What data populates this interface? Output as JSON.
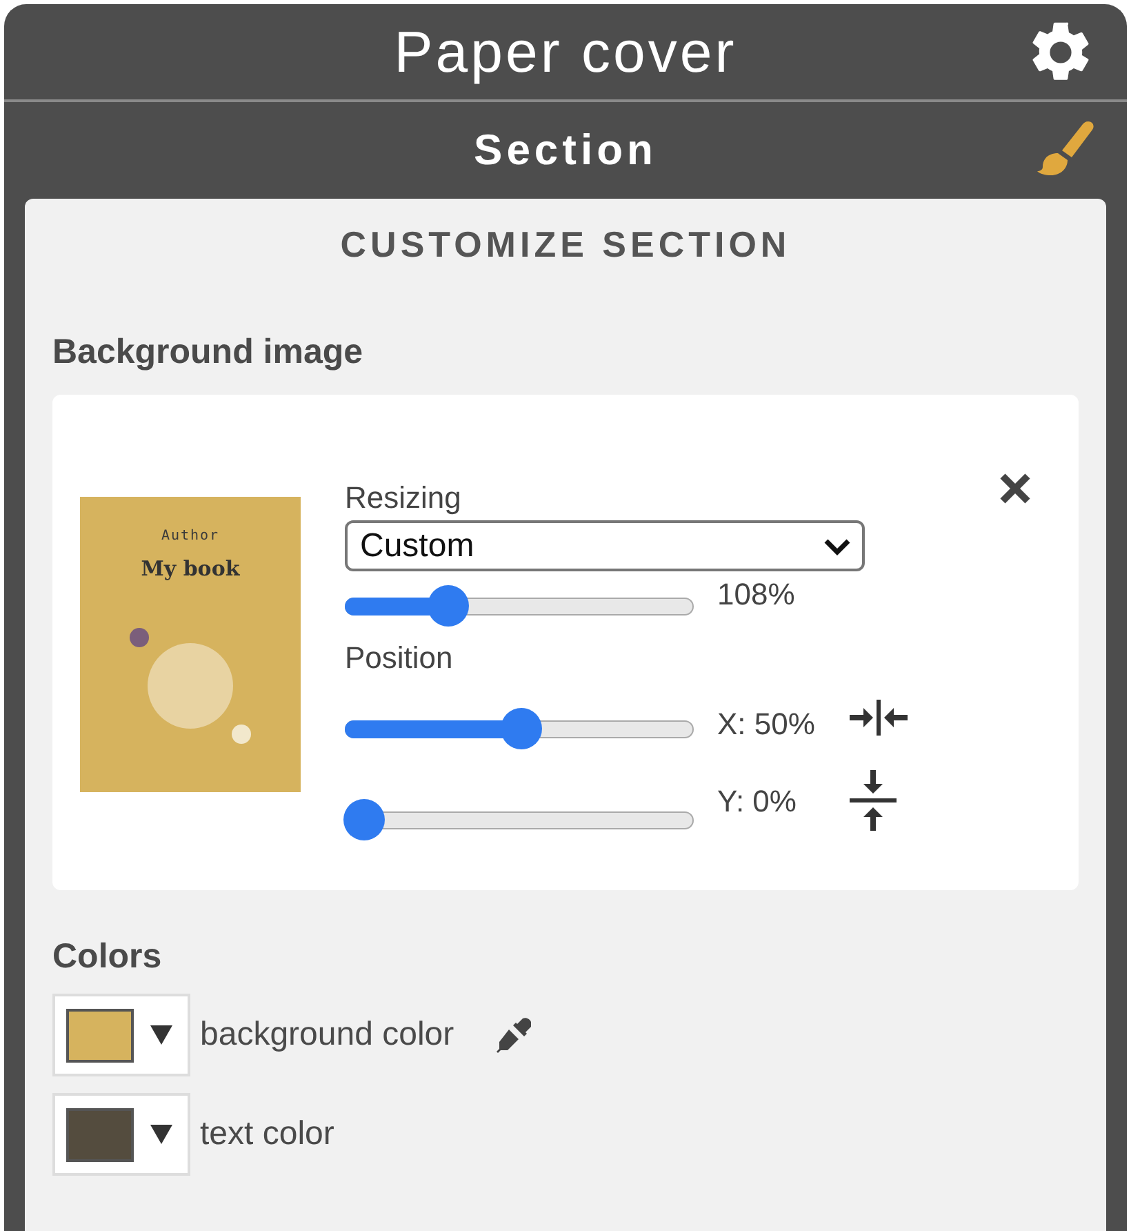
{
  "window": {
    "title": "Paper cover"
  },
  "section": {
    "title": "Section"
  },
  "panel": {
    "heading": "CUSTOMIZE SECTION",
    "background_image": {
      "label": "Background image",
      "cover": {
        "author": "Author",
        "title": "My book"
      },
      "resizing": {
        "label": "Resizing",
        "value": "Custom",
        "level": 0.27,
        "reading": "108%"
      },
      "position": {
        "label": "Position",
        "sliders": [
          {
            "kind": "horizontal",
            "level": 0.5,
            "reading": "X: 50%"
          },
          {
            "kind": "vertical",
            "level": 0,
            "reading": "Y: 0%"
          }
        ]
      }
    },
    "colors": {
      "label": "Colors",
      "items": [
        {
          "label": "background color",
          "color": "#d6b35e",
          "eyedropper": true
        },
        {
          "label": "text color",
          "color": "#544c3e",
          "eyedropper": false
        }
      ]
    }
  }
}
